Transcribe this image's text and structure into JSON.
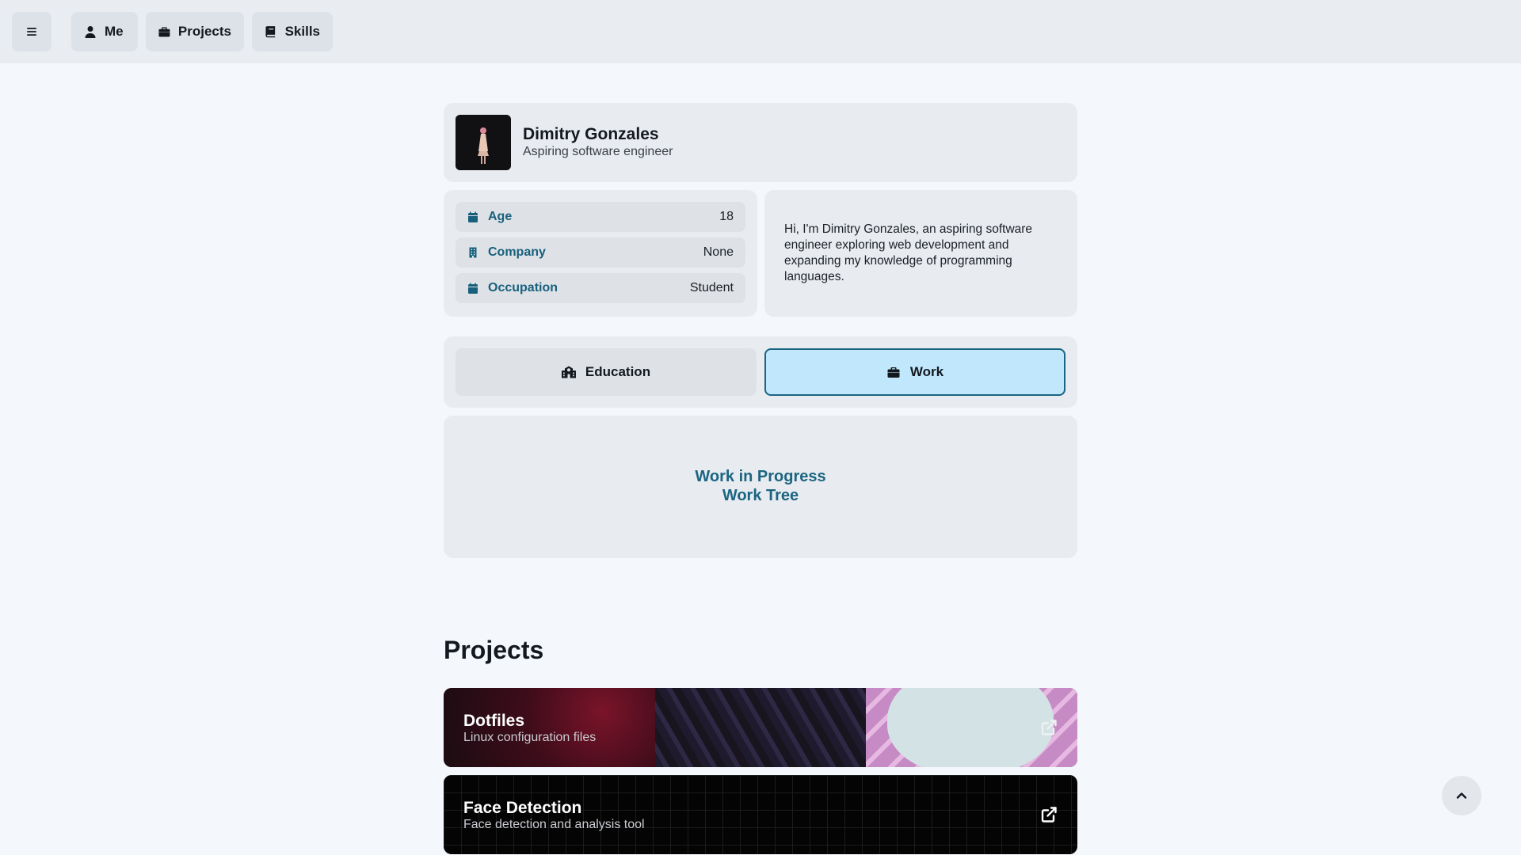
{
  "nav": {
    "menu_icon": "hamburger-icon",
    "items": [
      {
        "label": "Me",
        "icon": "user-icon"
      },
      {
        "label": "Projects",
        "icon": "briefcase-icon"
      },
      {
        "label": "Skills",
        "icon": "book-icon"
      }
    ]
  },
  "profile": {
    "name": "Dimitry Gonzales",
    "subtitle": "Aspiring software engineer"
  },
  "info": {
    "rows": [
      {
        "label": "Age",
        "value": "18",
        "icon": "calendar-icon"
      },
      {
        "label": "Company",
        "value": "None",
        "icon": "building-icon"
      },
      {
        "label": "Occupation",
        "value": "Student",
        "icon": "calendar-icon"
      }
    ]
  },
  "bio": {
    "text": "Hi, I'm Dimitry Gonzales, an aspiring software engineer exploring web development and expanding my knowledge of programming languages."
  },
  "tabs": {
    "items": [
      {
        "label": "Education",
        "icon": "school-icon",
        "active": false
      },
      {
        "label": "Work",
        "icon": "briefcase-icon",
        "active": true
      }
    ]
  },
  "work_panel": {
    "line1": "Work in Progress",
    "line2": "Work Tree"
  },
  "projects": {
    "title": "Projects",
    "items": [
      {
        "title": "Dotfiles",
        "subtitle": "Linux configuration files",
        "icon": "external-link-icon"
      },
      {
        "title": "Face Detection",
        "subtitle": "Face detection and analysis tool",
        "icon": "external-link-icon"
      }
    ]
  },
  "scroll_top_icon": "chevron-up-icon",
  "colors": {
    "accent": "#18607c",
    "active_tab_bg": "#c0e7fb",
    "page_bg": "#f4f8fd"
  }
}
